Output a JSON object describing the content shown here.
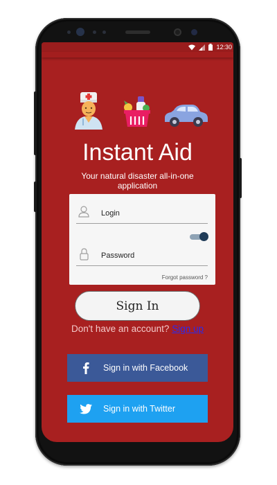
{
  "status_bar": {
    "time": "12:30"
  },
  "app": {
    "title": "Instant Aid",
    "subtitle": "Your natural disaster all-in-one application"
  },
  "form": {
    "login_label": "Login",
    "password_label": "Password",
    "remember_toggle_on": true,
    "forgot_password": "Forgot password ?"
  },
  "actions": {
    "sign_in": "Sign In",
    "no_account_text": "Don't have an account?",
    "sign_up": "Sign up",
    "facebook": "Sign in with Facebook",
    "twitter": "Sign in with Twitter"
  },
  "icons": [
    "doctor-icon",
    "grocery-basket-icon",
    "car-icon",
    "user-icon",
    "lock-icon",
    "facebook-icon",
    "twitter-icon",
    "wifi-icon",
    "signal-icon",
    "battery-icon"
  ],
  "colors": {
    "background": "#a82020",
    "facebook": "#3b5998",
    "twitter": "#1ea1f1",
    "link": "#2a2aee",
    "toggle_knob": "#1f3b57"
  }
}
